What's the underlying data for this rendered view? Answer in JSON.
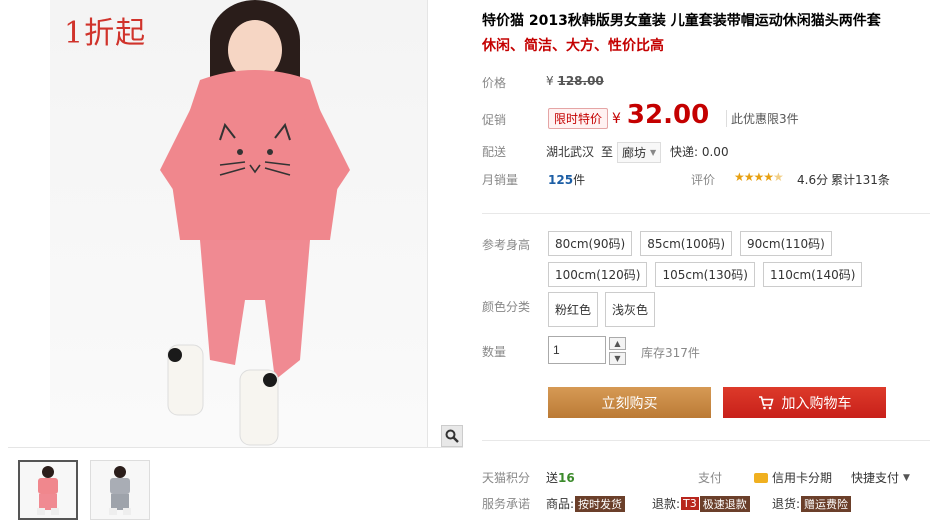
{
  "gallery": {
    "discount_tag": "1折起",
    "zoom_icon": "magnifier-icon"
  },
  "product": {
    "title": "特价猫 2013秋韩版男女童装 儿童套装带帽运动休闲猫头两件套",
    "subtitle": "休闲、简洁、大方、性价比高"
  },
  "price": {
    "label": "价格",
    "currency": "¥",
    "original": "128.00",
    "promo_label": "促销",
    "promo_tag": "限时特价",
    "current": "32.00",
    "limit_text": "此优惠限3件"
  },
  "shipping": {
    "label": "配送",
    "from": "湖北武汉",
    "to_word": "至",
    "destination": "廊坊",
    "fee": "快递: 0.00"
  },
  "sales": {
    "label": "月销量",
    "count": "125",
    "unit": "件",
    "rating_label": "评价",
    "stars": 4.6,
    "score": "4.6分",
    "total": "累计131条"
  },
  "size": {
    "label": "参考身高",
    "options": [
      "80cm(90码)",
      "85cm(100码)",
      "90cm(110码)",
      "100cm(120码)",
      "105cm(130码)",
      "110cm(140码)"
    ]
  },
  "color": {
    "label": "颜色分类",
    "options": [
      "粉红色",
      "浅灰色"
    ]
  },
  "quantity": {
    "label": "数量",
    "value": "1",
    "stock": "库存317件"
  },
  "actions": {
    "buy_now": "立刻购买",
    "add_cart": "加入购物车"
  },
  "footer": {
    "points_label": "天猫积分",
    "points_prefix": "送",
    "points_value": "16",
    "pay_label": "支付",
    "credit_card": "信用卡分期",
    "quick_pay": "快捷支付",
    "service_label": "服务承诺",
    "goods_prefix": "商品:",
    "goods_badge": "按时发货",
    "refund_prefix": "退款:",
    "refund_t3": "T3",
    "refund_badge": "极速退款",
    "return_prefix": "退货:",
    "return_badge": "赠运费险"
  },
  "colors": {
    "accent_red": "#c40000",
    "buy_button": "#c88a45",
    "cart_button": "#d02b20",
    "star": "#e7a012"
  }
}
